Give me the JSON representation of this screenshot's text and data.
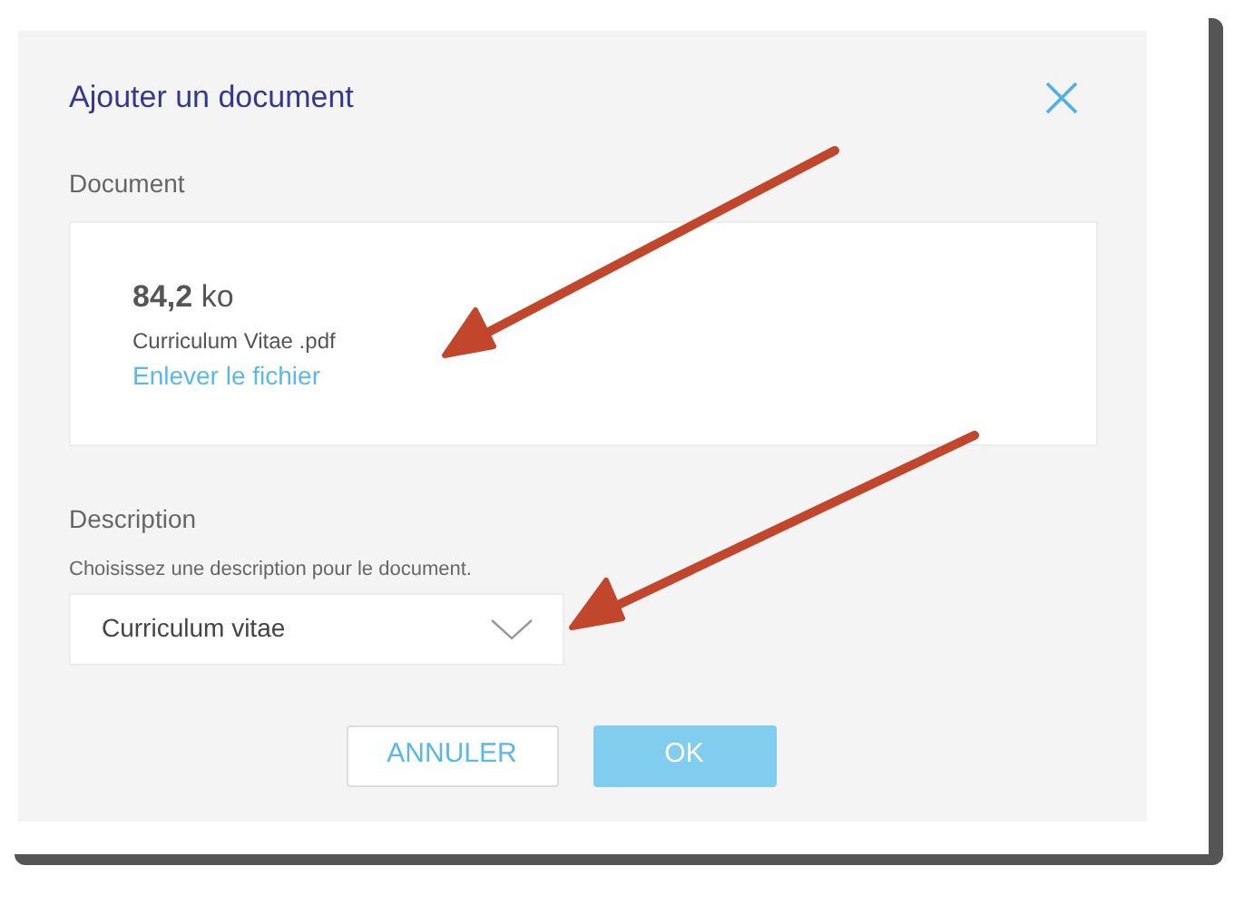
{
  "dialog": {
    "title": "Ajouter un document",
    "document": {
      "label": "Document",
      "file": {
        "size": "**84,2** ko",
        "name": "Curriculum Vitae .pdf",
        "remove_link": "Enlever le fichier"
      }
    },
    "description": {
      "label": "Description",
      "hint": "Choisissez une description pour le document.",
      "value": "Curriculum vitae"
    },
    "buttons": [
      {
        "label": "ANNULER",
        "kind": "secondary"
      },
      {
        "label": "OK",
        "kind": "primary"
      }
    ]
  }
}
